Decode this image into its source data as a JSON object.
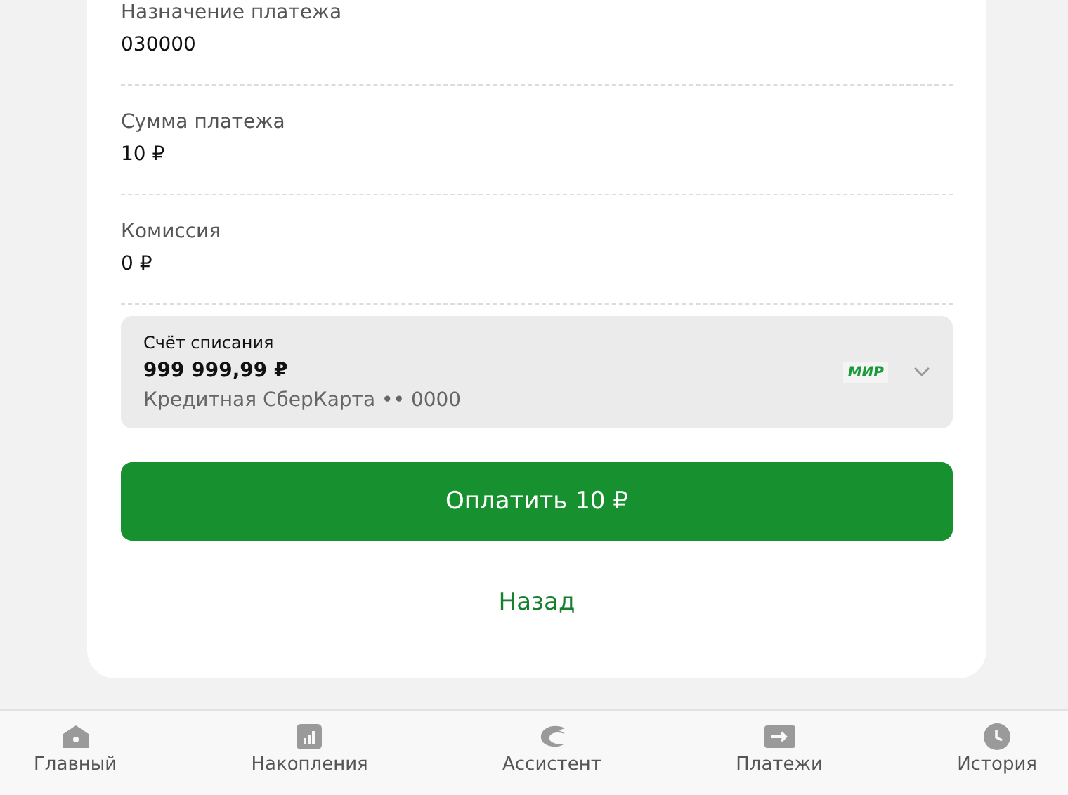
{
  "fields": [
    {
      "label": "Назначение платежа",
      "value": "030000"
    },
    {
      "label": "Сумма платежа",
      "value": "10 ₽"
    },
    {
      "label": "Комиссия",
      "value": "0 ₽"
    }
  ],
  "account": {
    "label": "Счёт списания",
    "balance": "999 999,99 ₽",
    "card": "Кредитная СберКарта •• 0000",
    "brand": "МИР"
  },
  "pay_button": "Оплатить 10 ₽",
  "back_link": "Назад",
  "nav": [
    {
      "label": "Главный",
      "kind": "home"
    },
    {
      "label": "Накопления",
      "kind": "chart"
    },
    {
      "label": "Ассистент",
      "kind": "assistant"
    },
    {
      "label": "Платежи",
      "kind": "arrow"
    },
    {
      "label": "История",
      "kind": "clock"
    }
  ]
}
